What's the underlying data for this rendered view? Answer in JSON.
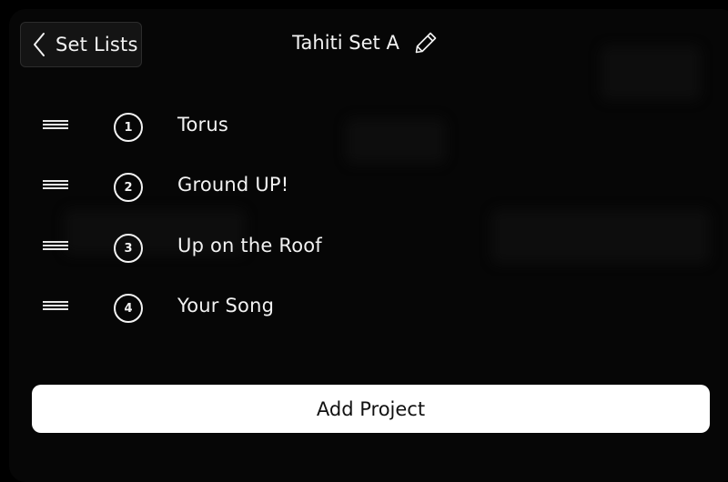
{
  "header": {
    "back_label": "Set Lists",
    "title": "Tahiti Set A"
  },
  "songs": [
    {
      "number": "1",
      "title": "Torus"
    },
    {
      "number": "2",
      "title": "Ground UP!"
    },
    {
      "number": "3",
      "title": "Up on the Roof"
    },
    {
      "number": "4",
      "title": "Your Song"
    }
  ],
  "footer": {
    "add_label": "Add Project"
  },
  "icons": {
    "back": "chevron-left-icon",
    "edit": "pencil-icon",
    "drag": "drag-handle-icon"
  },
  "colors": {
    "background": "#000000",
    "text": "#f2f2f2",
    "button_bg": "#ffffff",
    "button_text": "#111111"
  }
}
